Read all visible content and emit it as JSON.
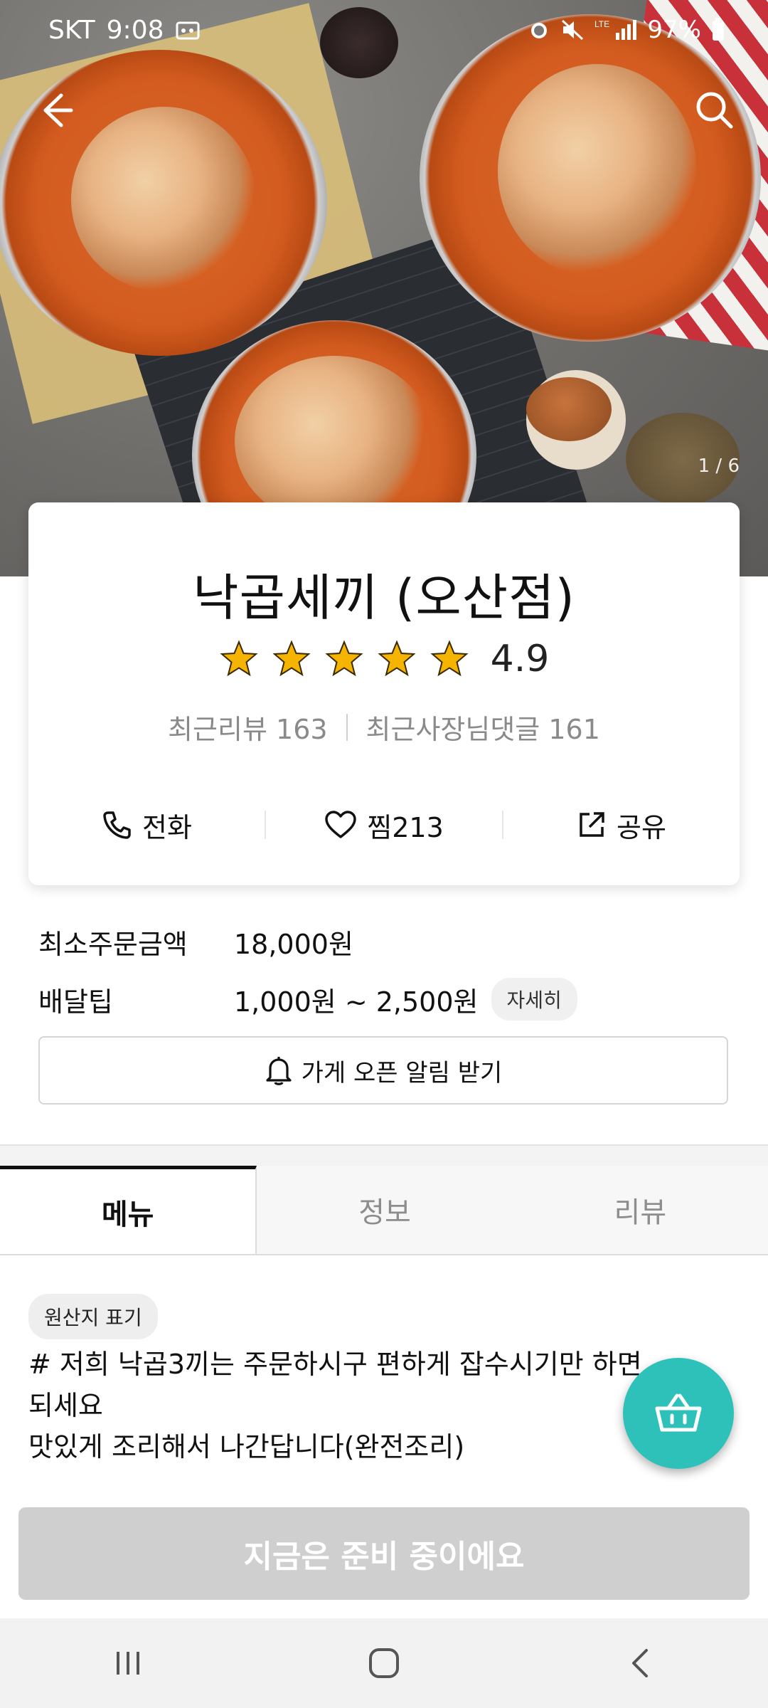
{
  "status_bar": {
    "carrier": "SKT",
    "time": "9:08",
    "battery": "97%"
  },
  "hero": {
    "pager": "1 / 6"
  },
  "store": {
    "name": "낙곱세끼 (오산점)",
    "rating": "4.9",
    "rating_value": 4.9,
    "stars": 5,
    "recent_reviews": "최근리뷰 163",
    "owner_replies": "최근사장님댓글 161"
  },
  "actions": {
    "call": "전화",
    "like": "찜213",
    "share": "공유"
  },
  "order_info": {
    "min_order_label": "최소주문금액",
    "min_order_value": "18,000원",
    "delivery_tip_label": "배달팁",
    "delivery_tip_value": "1,000원 ~ 2,500원",
    "detail_badge": "자세히"
  },
  "open_alert": "가게 오픈 알림 받기",
  "tabs": [
    {
      "label": "메뉴",
      "active": true
    },
    {
      "label": "정보",
      "active": false
    },
    {
      "label": "리뷰",
      "active": false
    }
  ],
  "menu": {
    "origin_chip": "원산지 표기",
    "description": "# 저희 낙곱3끼는 주문하시구 편하게 잡수시기만 하면\n되세요\n 맛있게 조리해서 나간답니다(완전조리)"
  },
  "bottom_button": "지금은 준비 중이에요",
  "colors": {
    "accent_teal": "#2ec1b9",
    "star_gold": "#f5b400",
    "disabled_button": "#cfcfcf"
  },
  "icons": [
    "back-arrow-icon",
    "search-icon",
    "phone-icon",
    "heart-icon",
    "share-icon",
    "bell-icon",
    "basket-icon",
    "recents-icon",
    "home-icon",
    "back-icon"
  ]
}
